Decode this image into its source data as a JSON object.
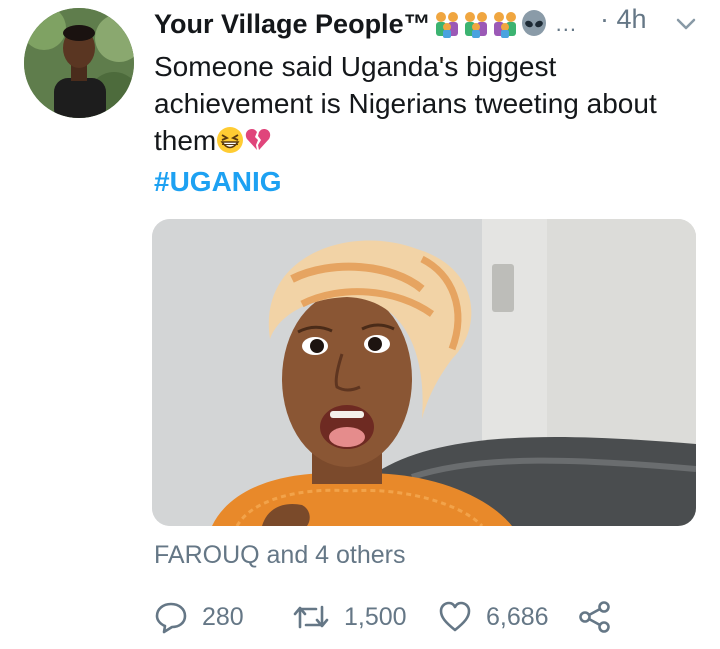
{
  "user": {
    "display_name": "Your Village People™",
    "name_emojis": [
      "family-icon",
      "family-icon",
      "family-icon",
      "alien-icon"
    ],
    "overflow": "...",
    "time": "· 4h"
  },
  "tweet": {
    "text_main": "Someone said Uganda's biggest achievement is Nigerians tweeting about them",
    "text_emojis": [
      "grinning-squint-icon",
      "broken-heart-icon"
    ],
    "hashtag": "#UGANIG"
  },
  "social": {
    "liked_by": "FAROUQ and 4 others"
  },
  "actions": {
    "reply_count": "280",
    "retweet_count": "1,500",
    "like_count": "6,686"
  },
  "colors": {
    "text": "#14171a",
    "secondary": "#657786",
    "hashtag": "#1da1f2"
  }
}
